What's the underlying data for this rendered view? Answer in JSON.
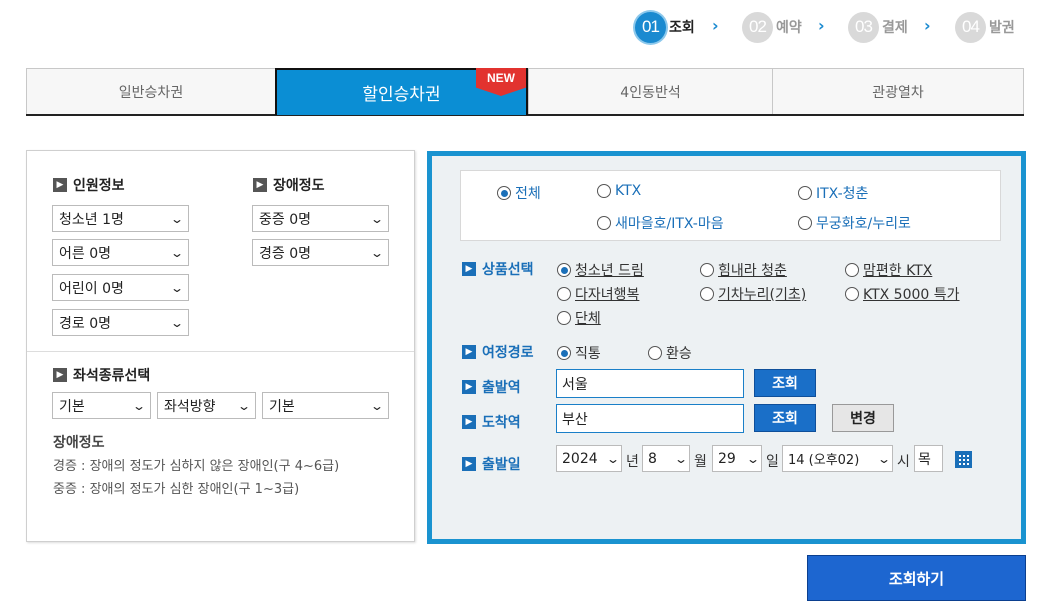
{
  "steps": [
    {
      "num": "01",
      "label": "조회"
    },
    {
      "num": "02",
      "label": "예약"
    },
    {
      "num": "03",
      "label": "결제"
    },
    {
      "num": "04",
      "label": "발권"
    }
  ],
  "step_arrow": "›",
  "tabs": [
    "일반승차권",
    "할인승차권",
    "4인동반석",
    "관광열차"
  ],
  "new_badge": "NEW",
  "left": {
    "passenger_title": "인원정보",
    "disability_title": "장애정도",
    "passengers": [
      "청소년 1명",
      "어른 0명",
      "어린이 0명",
      "경로 0명"
    ],
    "disability": [
      "중증 0명",
      "경증 0명"
    ],
    "seat_title": "좌석종류선택",
    "seat_options": [
      "기본",
      "좌석방향",
      "기본"
    ],
    "disability_info_title": "장애정도",
    "disability_info": [
      "경증 : 장애의 정도가 심하지 않은 장애인(구 4~6급)",
      "중증 : 장애의 정도가 심한 장애인(구 1~3급)"
    ]
  },
  "train_types": [
    "전체",
    "KTX",
    "ITX-청춘",
    "새마을호/ITX-마음",
    "무궁화호/누리로"
  ],
  "product_label": "상품선택",
  "products": [
    "청소년 드림",
    "힘내라 청춘",
    "맘편한 KTX",
    "다자녀행복",
    "기차누리(기초)",
    "KTX 5000 특가",
    "단체"
  ],
  "route_label": "여정경로",
  "routes": [
    "직통",
    "환승"
  ],
  "departure_label": "출발역",
  "departure_value": "서울",
  "arrival_label": "도착역",
  "arrival_value": "부산",
  "lookup_btn": "조회",
  "change_btn": "변경",
  "date_label": "출발일",
  "date": {
    "year": "2024",
    "year_unit": "년",
    "month": "8",
    "month_unit": "월",
    "day": "29",
    "day_unit": "일",
    "hour": "14 (오후02)",
    "hour_unit": "시",
    "weekday": "목"
  },
  "search_btn": "조회하기",
  "colors": {
    "accent": "#1a8ad0",
    "panel_border": "#1a93d0",
    "button": "#1d66d0"
  }
}
